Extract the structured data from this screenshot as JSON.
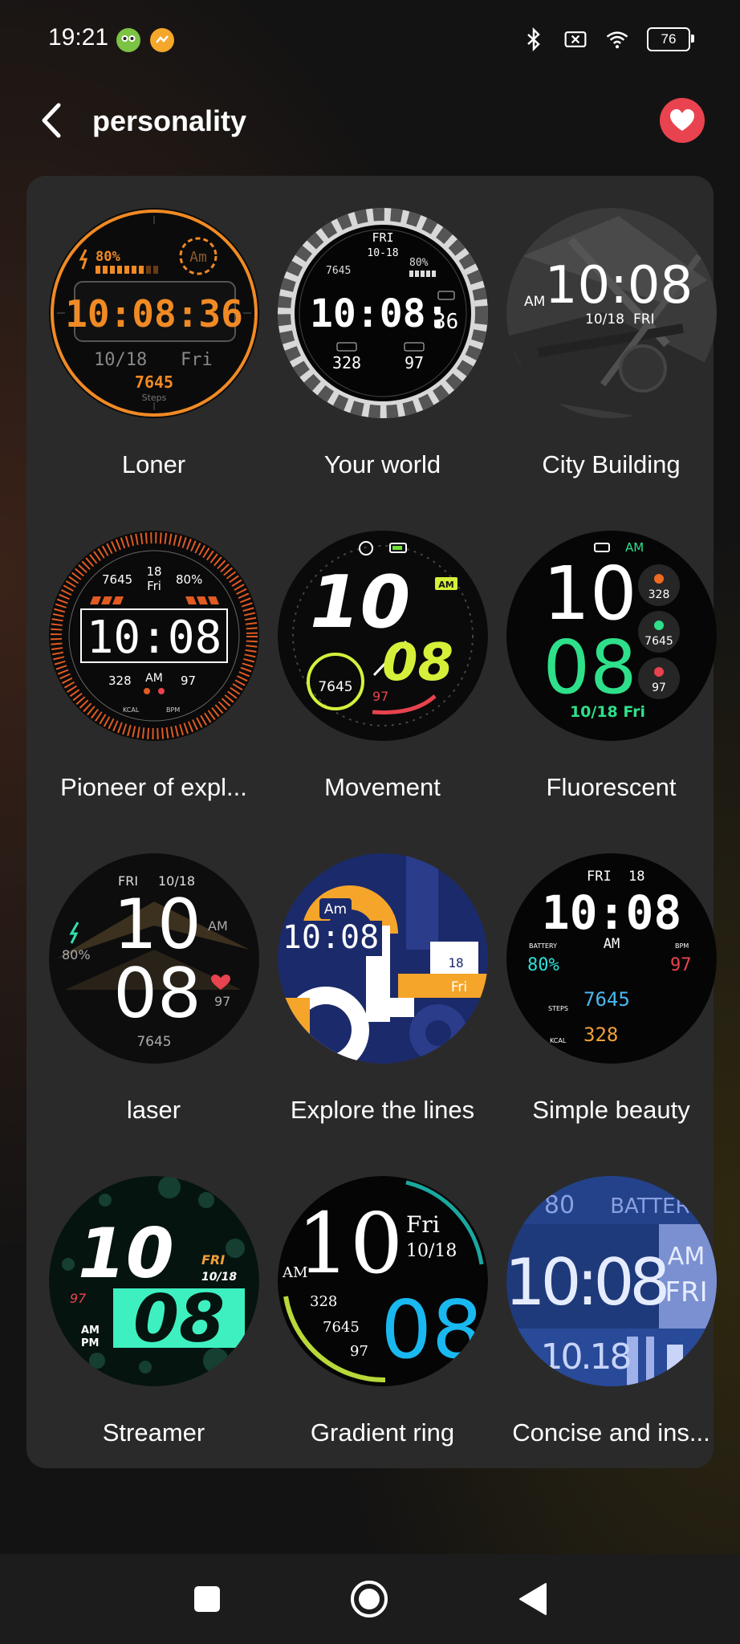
{
  "status_bar": {
    "time": "19:21",
    "battery_level": "76",
    "icons": [
      "duolingo-icon",
      "app-notification-icon",
      "bluetooth-icon",
      "no-sim-icon",
      "wifi-icon",
      "battery-icon"
    ]
  },
  "header": {
    "title": "personality",
    "back_icon": "chevron-left-icon",
    "favorite_icon": "heart-icon"
  },
  "faces": [
    {
      "label": "Loner",
      "time": "10:08:36",
      "battery": "80%",
      "date": "10/18",
      "day": "Fri",
      "steps": "7645",
      "steps_label": "Steps",
      "ampm": "Am"
    },
    {
      "label": "Your world",
      "time": "10:08:",
      "seconds": "36",
      "day": "FRI",
      "date": "10-18",
      "steps": "7645",
      "battery": "80%",
      "calories": "328",
      "bpm": "97"
    },
    {
      "label": "City Building",
      "time": "10:08",
      "ampm": "AM",
      "date": "10/18",
      "day": "FRI"
    },
    {
      "label": "Pioneer of expl...",
      "time": "10:08",
      "steps": "7645",
      "date_num": "18",
      "day": "Fri",
      "battery": "80%",
      "calories": "328",
      "ampm": "AM",
      "bpm": "97",
      "kcal_label": "KCAL",
      "bpm_label": "BPM"
    },
    {
      "label": "Movement",
      "hour": "10",
      "minute": "08",
      "ampm": "AM",
      "steps": "7645",
      "bpm": "97"
    },
    {
      "label": "Fluorescent",
      "hour": "10",
      "minute": "08",
      "ampm": "AM",
      "calories": "328",
      "steps": "7645",
      "bpm": "97",
      "date": "10/18 Fri"
    },
    {
      "label": "laser",
      "day": "FRI",
      "date": "10/18",
      "hour": "10",
      "minute": "08",
      "ampm": "AM",
      "battery": "80%",
      "bpm": "97",
      "steps": "7645"
    },
    {
      "label": "Explore the lines",
      "ampm": "Am",
      "time": "10:08",
      "date_num": "18",
      "day": "Fri"
    },
    {
      "label": "Simple beauty",
      "day": "FRI",
      "date_num": "18",
      "time": "10:08",
      "ampm": "AM",
      "battery_label": "BATTERY",
      "battery": "80%",
      "bpm_label": "BPM",
      "bpm": "97",
      "steps_label": "STEPS",
      "steps": "7645",
      "kcal_label": "KCAL",
      "calories": "328"
    },
    {
      "label": "Streamer",
      "hour": "10",
      "minute": "08",
      "day": "FRI",
      "date": "10/18",
      "bpm": "97",
      "am": "AM",
      "pm": "PM"
    },
    {
      "label": "Gradient ring",
      "hour": "10",
      "minute": "08",
      "day": "Fri",
      "date": "10/18",
      "ampm": "AM",
      "calories": "328",
      "steps": "7645",
      "bpm": "97"
    },
    {
      "label": "Concise and ins...",
      "battery": "80",
      "battery_label": "BATTERY",
      "time": "10:08",
      "ampm": "AM",
      "day": "FRI",
      "date": "10.18"
    }
  ],
  "nav_bar": {
    "icons": [
      "recents-square-icon",
      "home-circle-icon",
      "back-triangle-icon"
    ]
  },
  "colors": {
    "favorite": "#e8434e",
    "card_bg": "#2b2a2a",
    "loner_orange": "#f08a24",
    "fluorescent_green": "#2ee08a",
    "movement_yellow": "#d6f03a",
    "streamer_teal": "#3ef0c0",
    "gradient_blue": "#19b8f0"
  }
}
